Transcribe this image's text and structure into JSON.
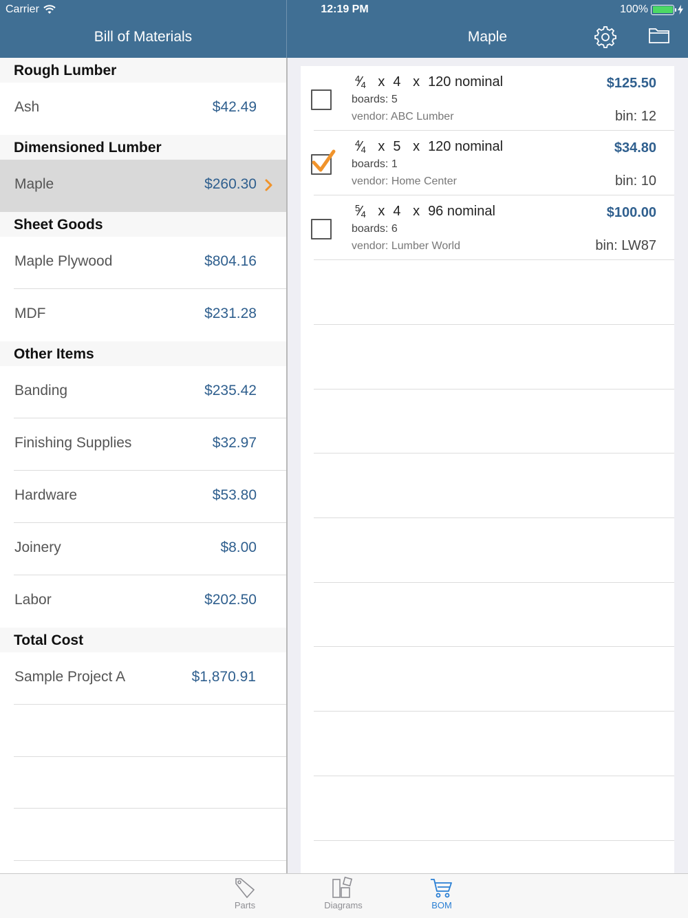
{
  "status_bar": {
    "carrier": "Carrier",
    "time": "12:19 PM",
    "battery": "100%"
  },
  "master": {
    "title": "Bill of Materials",
    "sections": [
      {
        "header": "Rough Lumber",
        "rows": [
          {
            "label": "Ash",
            "value": "$42.49"
          }
        ]
      },
      {
        "header": "Dimensioned Lumber",
        "rows": [
          {
            "label": "Maple",
            "value": "$260.30",
            "selected": true
          }
        ]
      },
      {
        "header": "Sheet Goods",
        "rows": [
          {
            "label": "Maple Plywood",
            "value": "$804.16"
          },
          {
            "label": "MDF",
            "value": "$231.28"
          }
        ]
      },
      {
        "header": "Other Items",
        "rows": [
          {
            "label": "Banding",
            "value": "$235.42"
          },
          {
            "label": "Finishing Supplies",
            "value": "$32.97"
          },
          {
            "label": "Hardware",
            "value": "$53.80"
          },
          {
            "label": "Joinery",
            "value": "$8.00"
          },
          {
            "label": "Labor",
            "value": "$202.50"
          }
        ]
      },
      {
        "header": "Total Cost",
        "rows": [
          {
            "label": "Sample Project A",
            "value": "$1,870.91"
          }
        ]
      }
    ]
  },
  "detail": {
    "title": "Maple",
    "items": [
      {
        "thickness_num": "4",
        "thickness_den": "4",
        "x1": "x",
        "width": "4",
        "x2": "x",
        "length": "120 nominal",
        "boards": "boards: 5",
        "vendor": "vendor: ABC Lumber",
        "price": "$125.50",
        "bin": "bin: 12",
        "checked": false
      },
      {
        "thickness_num": "4",
        "thickness_den": "4",
        "x1": "x",
        "width": "5",
        "x2": "x",
        "length": "120 nominal",
        "boards": "boards: 1",
        "vendor": "vendor: Home Center",
        "price": "$34.80",
        "bin": "bin: 10",
        "checked": true
      },
      {
        "thickness_num": "5",
        "thickness_den": "4",
        "x1": "x",
        "width": "4",
        "x2": "x",
        "length": "96 nominal",
        "boards": "boards: 6",
        "vendor": "vendor: Lumber World",
        "price": "$100.00",
        "bin": "bin: LW87",
        "checked": false
      }
    ]
  },
  "tabbar": {
    "tabs": [
      {
        "label": "Parts",
        "icon": "tag-icon"
      },
      {
        "label": "Diagrams",
        "icon": "diagrams-icon"
      },
      {
        "label": "BOM",
        "icon": "cart-icon",
        "active": true
      }
    ]
  },
  "colors": {
    "header": "#406f94",
    "accent": "#2f5f8e",
    "check": "#f0932b",
    "tab_active": "#2a7fd4",
    "selected_row": "#d9d9d9"
  }
}
